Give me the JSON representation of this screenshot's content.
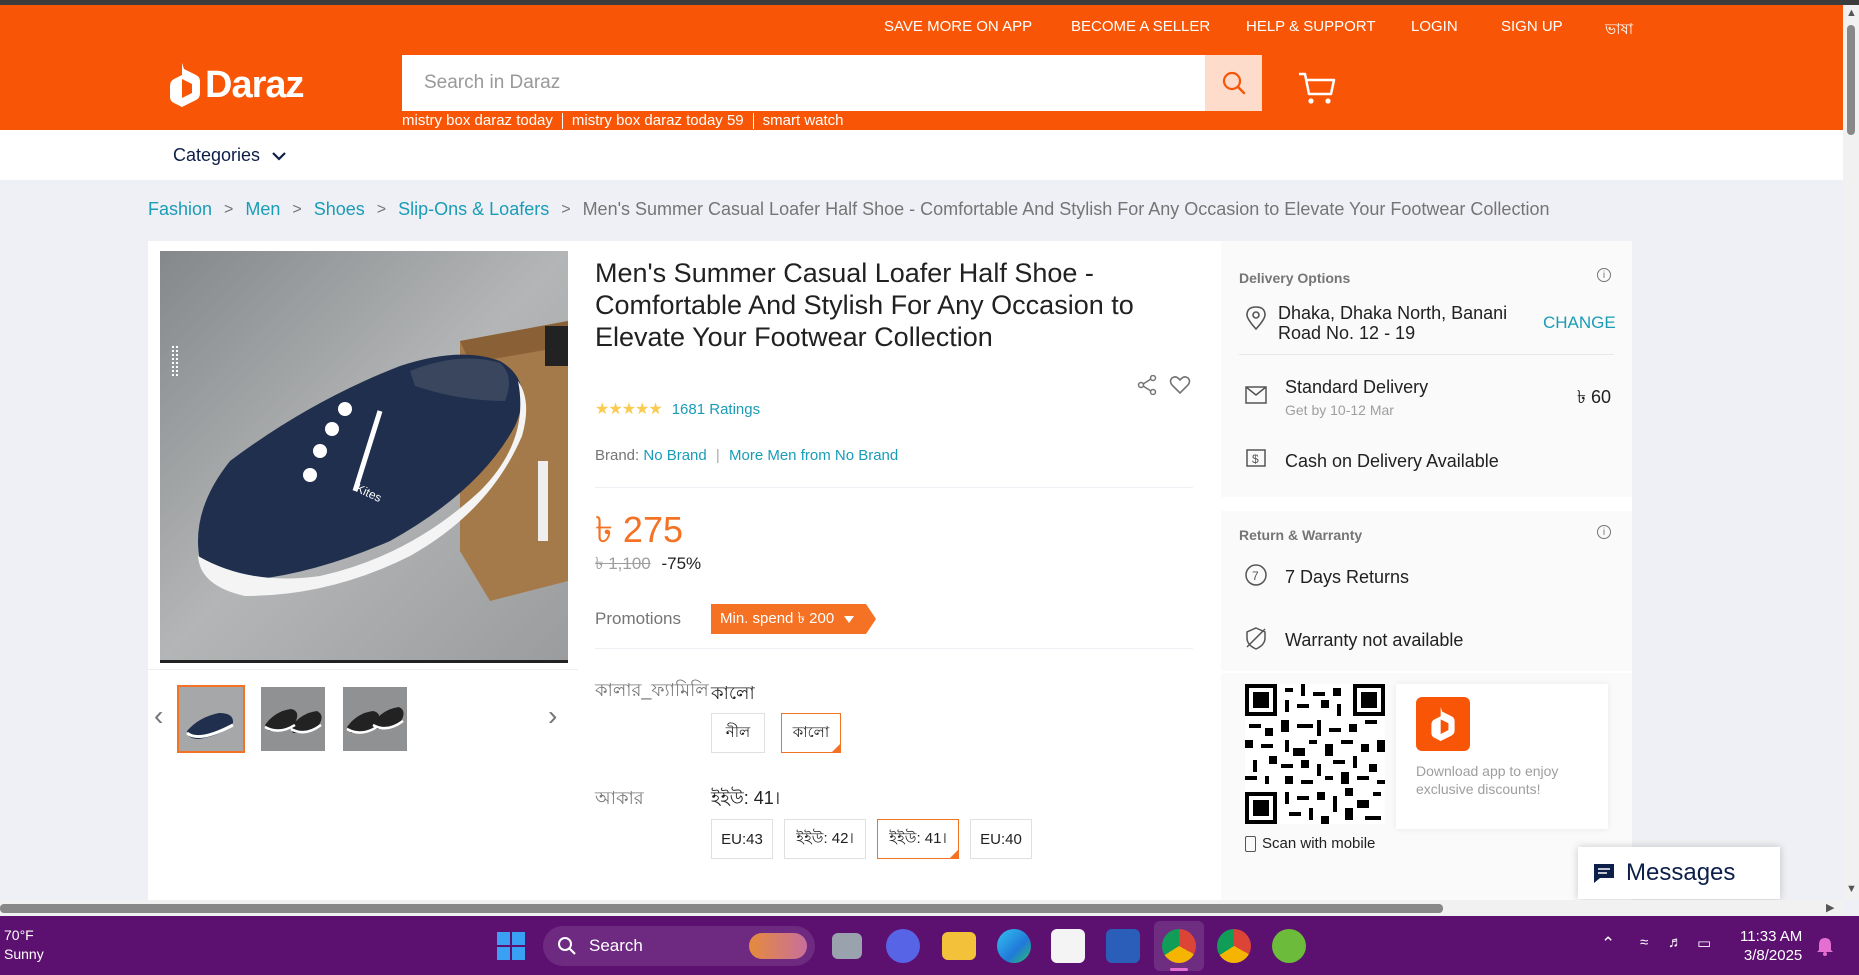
{
  "header": {
    "top_links": [
      "SAVE MORE ON APP",
      "BECOME A SELLER",
      "HELP & SUPPORT",
      "LOGIN",
      "SIGN UP",
      "ভাষা"
    ],
    "logo_text": "Daraz",
    "search_placeholder": "Search in Daraz",
    "suggestions": [
      "mistry box daraz today",
      "mistry box daraz today 59",
      "smart watch"
    ]
  },
  "categories_label": "Categories",
  "breadcrumb": {
    "items": [
      "Fashion",
      "Men",
      "Shoes",
      "Slip-Ons & Loafers"
    ],
    "current": "Men's Summer Casual Loafer Half Shoe - Comfortable And Stylish For Any Occasion to Elevate Your Footwear Collection"
  },
  "product": {
    "title": "Men's Summer Casual Loafer Half Shoe - Comfortable And Stylish For Any Occasion to Elevate Your Footwear Collection",
    "rating_stars": 4.5,
    "ratings_text": "1681 Ratings",
    "brand_label": "Brand:",
    "brand_name": "No Brand",
    "more_from": "More Men from No Brand",
    "price": "৳ 275",
    "original_price": "৳ 1,100",
    "discount": "-75%",
    "promotions_label": "Promotions",
    "promo_tag": "Min. spend ৳ 200",
    "color_label": "কালার_ফ্যামিলি",
    "color_selected": "কালো",
    "color_options": [
      "নীল",
      "কালো"
    ],
    "size_label": "আকার",
    "size_selected": "ইইউ: 41।",
    "size_options": [
      "EU:43",
      "ইইউ: 42।",
      "ইইউ: 41।",
      "EU:40"
    ],
    "image_brand_text": "Kites"
  },
  "delivery": {
    "section_title": "Delivery Options",
    "address": "Dhaka, Dhaka North, Banani Road No. 12 - 19",
    "change_label": "CHANGE",
    "standard_label": "Standard Delivery",
    "standard_eta": "Get by 10-12 Mar",
    "standard_price": "৳ 60",
    "cod_label": "Cash on Delivery Available"
  },
  "warranty": {
    "section_title": "Return & Warranty",
    "returns": "7 Days Returns",
    "warranty_text": "Warranty not available"
  },
  "app_promo": {
    "scan_text": "Scan with mobile",
    "download_text": "Download app to enjoy exclusive discounts!"
  },
  "messages_label": "Messages",
  "taskbar": {
    "temperature": "70°F",
    "weather": "Sunny",
    "search_label": "Search",
    "time": "11:33 AM",
    "date": "3/8/2025"
  },
  "colors": {
    "brand_orange": "#f85606",
    "price_orange": "#f57224",
    "link_blue": "#1a9cb7",
    "taskbar_purple": "#5c1170"
  }
}
